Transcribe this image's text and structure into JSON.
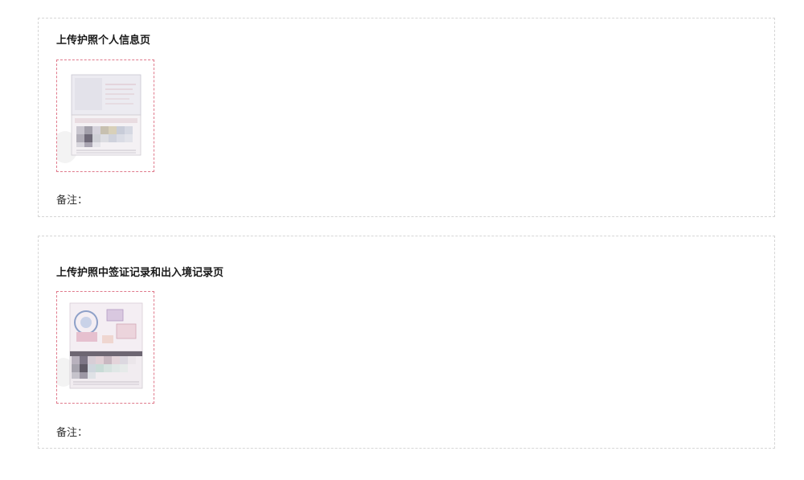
{
  "sections": [
    {
      "title": "上传护照个人信息页",
      "thumbnail_icon": "passport-info-page-thumbnail",
      "note_label": "备注："
    },
    {
      "title": "上传护照中签证记录和出入境记录页",
      "thumbnail_icon": "passport-visa-stamps-page-thumbnail",
      "note_label": "备注："
    }
  ],
  "colors": {
    "section_border": "#d6d6d6",
    "upload_border": "#e07a8c",
    "title_text": "#1a1a1a",
    "body_text": "#333333"
  }
}
